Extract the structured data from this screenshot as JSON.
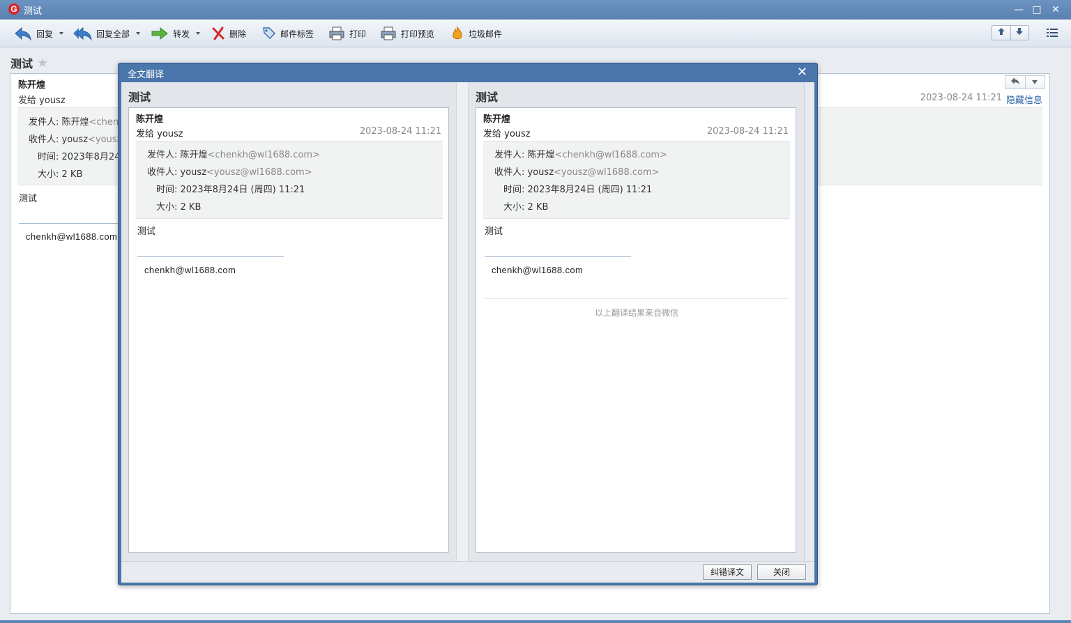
{
  "window": {
    "title": "测试",
    "logo_letter": "G",
    "minimize_glyph": "—",
    "maximize_glyph": "□",
    "close_glyph": "✕"
  },
  "toolbar": {
    "reply": "回复",
    "reply_all": "回复全部",
    "forward": "转发",
    "delete": "删除",
    "mail_tag": "邮件标签",
    "print": "打印",
    "print_preview": "打印预览",
    "spam": "垃圾邮件"
  },
  "message": {
    "subject": "测试",
    "star_glyph": "★",
    "from_name": "陈开煌",
    "to_line": "发给 yousz",
    "date": "2023-08-24 11:21",
    "hide_info": "隐藏信息",
    "sender_label": "发件人:",
    "sender_name": "陈开煌",
    "sender_email": "<chenk",
    "recipient_label": "收件人:",
    "recipient_name": "yousz",
    "recipient_email": "<yousz",
    "time_label": "时间:",
    "time_value": "2023年8月24",
    "size_label": "大小:",
    "size_value": "2 KB",
    "body": "测试",
    "signature": "chenkh@wl1688.com"
  },
  "dialog": {
    "title": "全文翻译",
    "close_glyph": "✕",
    "left": {
      "title": "测试",
      "from_name": "陈开煌",
      "to_line": "发给 yousz",
      "date": "2023-08-24 11:21",
      "sender_label": "发件人:",
      "sender_name": "陈开煌",
      "sender_email": "<chenkh@wl1688.com>",
      "recipient_label": "收件人:",
      "recipient_name": "yousz",
      "recipient_email": "<yousz@wl1688.com>",
      "time_label": "时间:",
      "time_value": "2023年8月24日 (周四) 11:21",
      "size_label": "大小:",
      "size_value": "2 KB",
      "body": "测试",
      "signature": "chenkh@wl1688.com"
    },
    "right": {
      "title": "测试",
      "from_name": "陈开煌",
      "to_line": "发给 yousz",
      "date": "2023-08-24 11:21",
      "sender_label": "发件人:",
      "sender_name": "陈开煌",
      "sender_email": "<chenkh@wl1688.com>",
      "recipient_label": "收件人:",
      "recipient_name": "yousz",
      "recipient_email": "<yousz@wl1688.com>",
      "time_label": "时间:",
      "time_value": "2023年8月24日 (周四) 11:21",
      "size_label": "大小:",
      "size_value": "2 KB",
      "body": "测试",
      "signature": "chenkh@wl1688.com",
      "note": "以上翻译结果来自微信"
    },
    "buttons": {
      "correct": "纠错译文",
      "close": "关闭"
    }
  },
  "colors": {
    "titlebar": "#5f86b3",
    "dialog_frame": "#4a76ab",
    "link": "#2d64a8"
  }
}
